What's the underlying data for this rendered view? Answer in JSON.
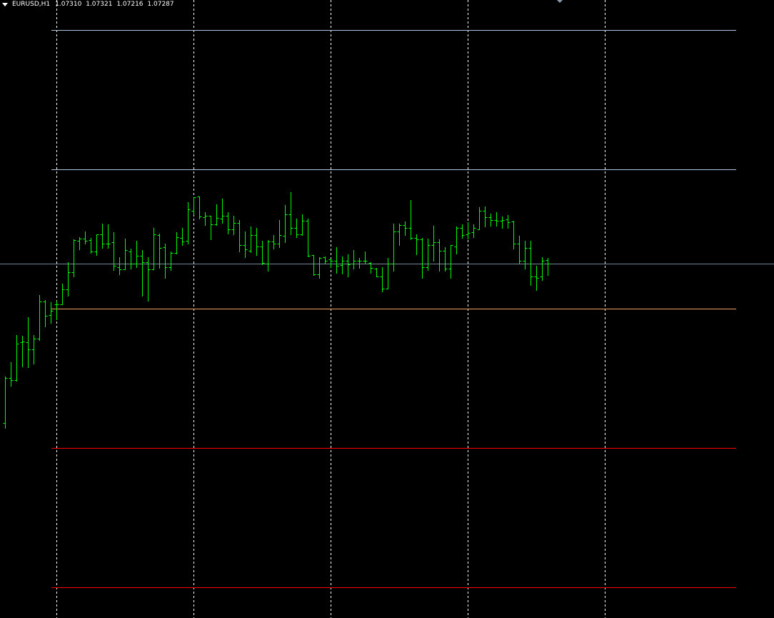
{
  "header": {
    "symbol": "EURUSD,H1",
    "open": "1.07310",
    "high": "1.07321",
    "low": "1.07216",
    "close": "1.07287"
  },
  "colors": {
    "background": "#000000",
    "bars": "#00ff00",
    "separator": "#ffffff",
    "bid_line": "#778899"
  },
  "chart_data": {
    "type": "ohlc",
    "symbol": "EURUSD",
    "timeframe": "H1",
    "ylim": [
      1.0512,
      1.089
    ],
    "bid": 1.07287,
    "period_separators_at_bar": [
      9,
      33,
      57,
      81,
      105
    ],
    "horizontal_lines": [
      {
        "price": 1.08715,
        "color": "#b0c4de"
      },
      {
        "price": 1.07865,
        "color": "#b0c4de"
      },
      {
        "price": 1.0701,
        "color": "#f4a460"
      },
      {
        "price": 1.0616,
        "color": "#ff0000"
      },
      {
        "price": 1.0531,
        "color": "#ff0000"
      }
    ],
    "bars": [
      [
        1.06311,
        1.06599,
        1.06284,
        1.0659
      ],
      [
        1.0659,
        1.06686,
        1.0654,
        1.06576
      ],
      [
        1.06576,
        1.0685,
        1.06572,
        1.068
      ],
      [
        1.06805,
        1.06846,
        1.06658,
        1.06809
      ],
      [
        1.06805,
        1.0696,
        1.06654,
        1.06763
      ],
      [
        1.06763,
        1.0685,
        1.06677,
        1.06827
      ],
      [
        1.06827,
        1.07097,
        1.06818,
        1.07056
      ],
      [
        1.07056,
        1.07065,
        1.06901,
        1.06969
      ],
      [
        1.06974,
        1.07051,
        1.06923,
        1.07001
      ],
      [
        1.07038,
        1.07061,
        1.06946,
        1.07038
      ],
      [
        1.07038,
        1.07166,
        1.07038,
        1.07129
      ],
      [
        1.07129,
        1.07298,
        1.07092,
        1.07234
      ],
      [
        1.07234,
        1.07435,
        1.07207,
        1.07431
      ],
      [
        1.07426,
        1.07449,
        1.07376,
        1.0744
      ],
      [
        1.0744,
        1.07486,
        1.07408,
        1.07426
      ],
      [
        1.07431,
        1.07444,
        1.07353,
        1.07362
      ],
      [
        1.07362,
        1.07467,
        1.07339,
        1.07467
      ],
      [
        1.07467,
        1.07531,
        1.07385,
        1.07408
      ],
      [
        1.07408,
        1.07527,
        1.07385,
        1.07412
      ],
      [
        1.07417,
        1.07481,
        1.07248,
        1.07275
      ],
      [
        1.07266,
        1.07326,
        1.0722,
        1.07252
      ],
      [
        1.07252,
        1.0744,
        1.07252,
        1.07371
      ],
      [
        1.07362,
        1.0738,
        1.07257,
        1.07289
      ],
      [
        1.07289,
        1.07426,
        1.07266,
        1.07335
      ],
      [
        1.07335,
        1.07371,
        1.07092,
        1.07298
      ],
      [
        1.07298,
        1.07326,
        1.07061,
        1.07252
      ],
      [
        1.07252,
        1.07508,
        1.07252,
        1.07467
      ],
      [
        1.07463,
        1.07472,
        1.07262,
        1.07385
      ],
      [
        1.0739,
        1.07408,
        1.07198,
        1.07266
      ],
      [
        1.07266,
        1.07362,
        1.07248,
        1.07353
      ],
      [
        1.07353,
        1.07481,
        1.07348,
        1.07449
      ],
      [
        1.07444,
        1.07504,
        1.07399,
        1.07422
      ],
      [
        1.07426,
        1.07664,
        1.07412,
        1.07618
      ],
      [
        1.07613,
        1.07696,
        1.07591,
        1.07696
      ],
      [
        1.077,
        1.077,
        1.07563,
        1.07577
      ],
      [
        1.07572,
        1.076,
        1.07522,
        1.07581
      ],
      [
        1.07581,
        1.07581,
        1.07435,
        1.07527
      ],
      [
        1.07527,
        1.0765,
        1.07522,
        1.07568
      ],
      [
        1.07563,
        1.07687,
        1.07536,
        1.07581
      ],
      [
        1.07581,
        1.07604,
        1.07472,
        1.07499
      ],
      [
        1.07499,
        1.07581,
        1.07467,
        1.07536
      ],
      [
        1.07536,
        1.07554,
        1.07362,
        1.07399
      ],
      [
        1.07403,
        1.07486,
        1.07326,
        1.07376
      ],
      [
        1.07367,
        1.07513,
        1.07358,
        1.07463
      ],
      [
        1.07463,
        1.07504,
        1.07339,
        1.07394
      ],
      [
        1.07394,
        1.07426,
        1.07284,
        1.07294
      ],
      [
        1.07289,
        1.07431,
        1.07243,
        1.07422
      ],
      [
        1.07422,
        1.07463,
        1.0738,
        1.07408
      ],
      [
        1.07408,
        1.07554,
        1.0739,
        1.07463
      ],
      [
        1.07458,
        1.07645,
        1.07417,
        1.07591
      ],
      [
        1.07591,
        1.07723,
        1.07467,
        1.07508
      ],
      [
        1.07508,
        1.07563,
        1.07449,
        1.07467
      ],
      [
        1.07467,
        1.07591,
        1.07463,
        1.0755
      ],
      [
        1.0755,
        1.07563,
        1.0733,
        1.07335
      ],
      [
        1.07339,
        1.07339,
        1.07216,
        1.0722
      ],
      [
        1.0722,
        1.07326,
        1.07198,
        1.07321
      ],
      [
        1.07326,
        1.0733,
        1.07289,
        1.07307
      ],
      [
        1.07312,
        1.07316,
        1.07266,
        1.07303
      ],
      [
        1.07303,
        1.0739,
        1.0723,
        1.07275
      ],
      [
        1.0728,
        1.0733,
        1.07225,
        1.07303
      ],
      [
        1.07303,
        1.07344,
        1.07211,
        1.07284
      ],
      [
        1.07289,
        1.07371,
        1.07257,
        1.07303
      ],
      [
        1.07303,
        1.07321,
        1.07262,
        1.07307
      ],
      [
        1.07307,
        1.07362,
        1.07289,
        1.07303
      ],
      [
        1.07294,
        1.07298,
        1.0723,
        1.07262
      ],
      [
        1.07257,
        1.07262,
        1.07211,
        1.07211
      ],
      [
        1.07211,
        1.07266,
        1.07115,
        1.07134
      ],
      [
        1.07134,
        1.07321,
        1.07134,
        1.07289
      ],
      [
        1.07289,
        1.07531,
        1.07243,
        1.07486
      ],
      [
        1.07486,
        1.07531,
        1.07403,
        1.07522
      ],
      [
        1.07522,
        1.07545,
        1.07463,
        1.07508
      ],
      [
        1.07508,
        1.07677,
        1.07435,
        1.07444
      ],
      [
        1.07444,
        1.07467,
        1.07344,
        1.07435
      ],
      [
        1.07435,
        1.07444,
        1.07198,
        1.07266
      ],
      [
        1.07266,
        1.0744,
        1.07248,
        1.07399
      ],
      [
        1.07399,
        1.07518,
        1.07307,
        1.07417
      ],
      [
        1.07417,
        1.07435,
        1.07243,
        1.07367
      ],
      [
        1.07367,
        1.0739,
        1.07243,
        1.07257
      ],
      [
        1.07257,
        1.07403,
        1.07198,
        1.07399
      ],
      [
        1.07394,
        1.07513,
        1.07348,
        1.07504
      ],
      [
        1.07508,
        1.07527,
        1.07444,
        1.07463
      ],
      [
        1.07467,
        1.0754,
        1.0744,
        1.07476
      ],
      [
        1.07481,
        1.07527,
        1.07449,
        1.07508
      ],
      [
        1.07499,
        1.07632,
        1.07499,
        1.07609
      ],
      [
        1.07609,
        1.07636,
        1.07513,
        1.07572
      ],
      [
        1.07572,
        1.07595,
        1.07517,
        1.07554
      ],
      [
        1.07554,
        1.07604,
        1.07517,
        1.0755
      ],
      [
        1.0755,
        1.07577,
        1.07508,
        1.07554
      ],
      [
        1.07559,
        1.07586,
        1.07508,
        1.0754
      ],
      [
        1.07545,
        1.0755,
        1.0738,
        1.07408
      ],
      [
        1.07408,
        1.07458,
        1.07289,
        1.07303
      ],
      [
        1.07303,
        1.07426,
        1.07257,
        1.07385
      ],
      [
        1.07385,
        1.07426,
        1.07156,
        1.07207
      ],
      [
        1.07207,
        1.07275,
        1.07124,
        1.07202
      ],
      [
        1.07207,
        1.07326,
        1.07188,
        1.07307
      ],
      [
        1.0731,
        1.07321,
        1.07216,
        1.07287
      ]
    ]
  }
}
